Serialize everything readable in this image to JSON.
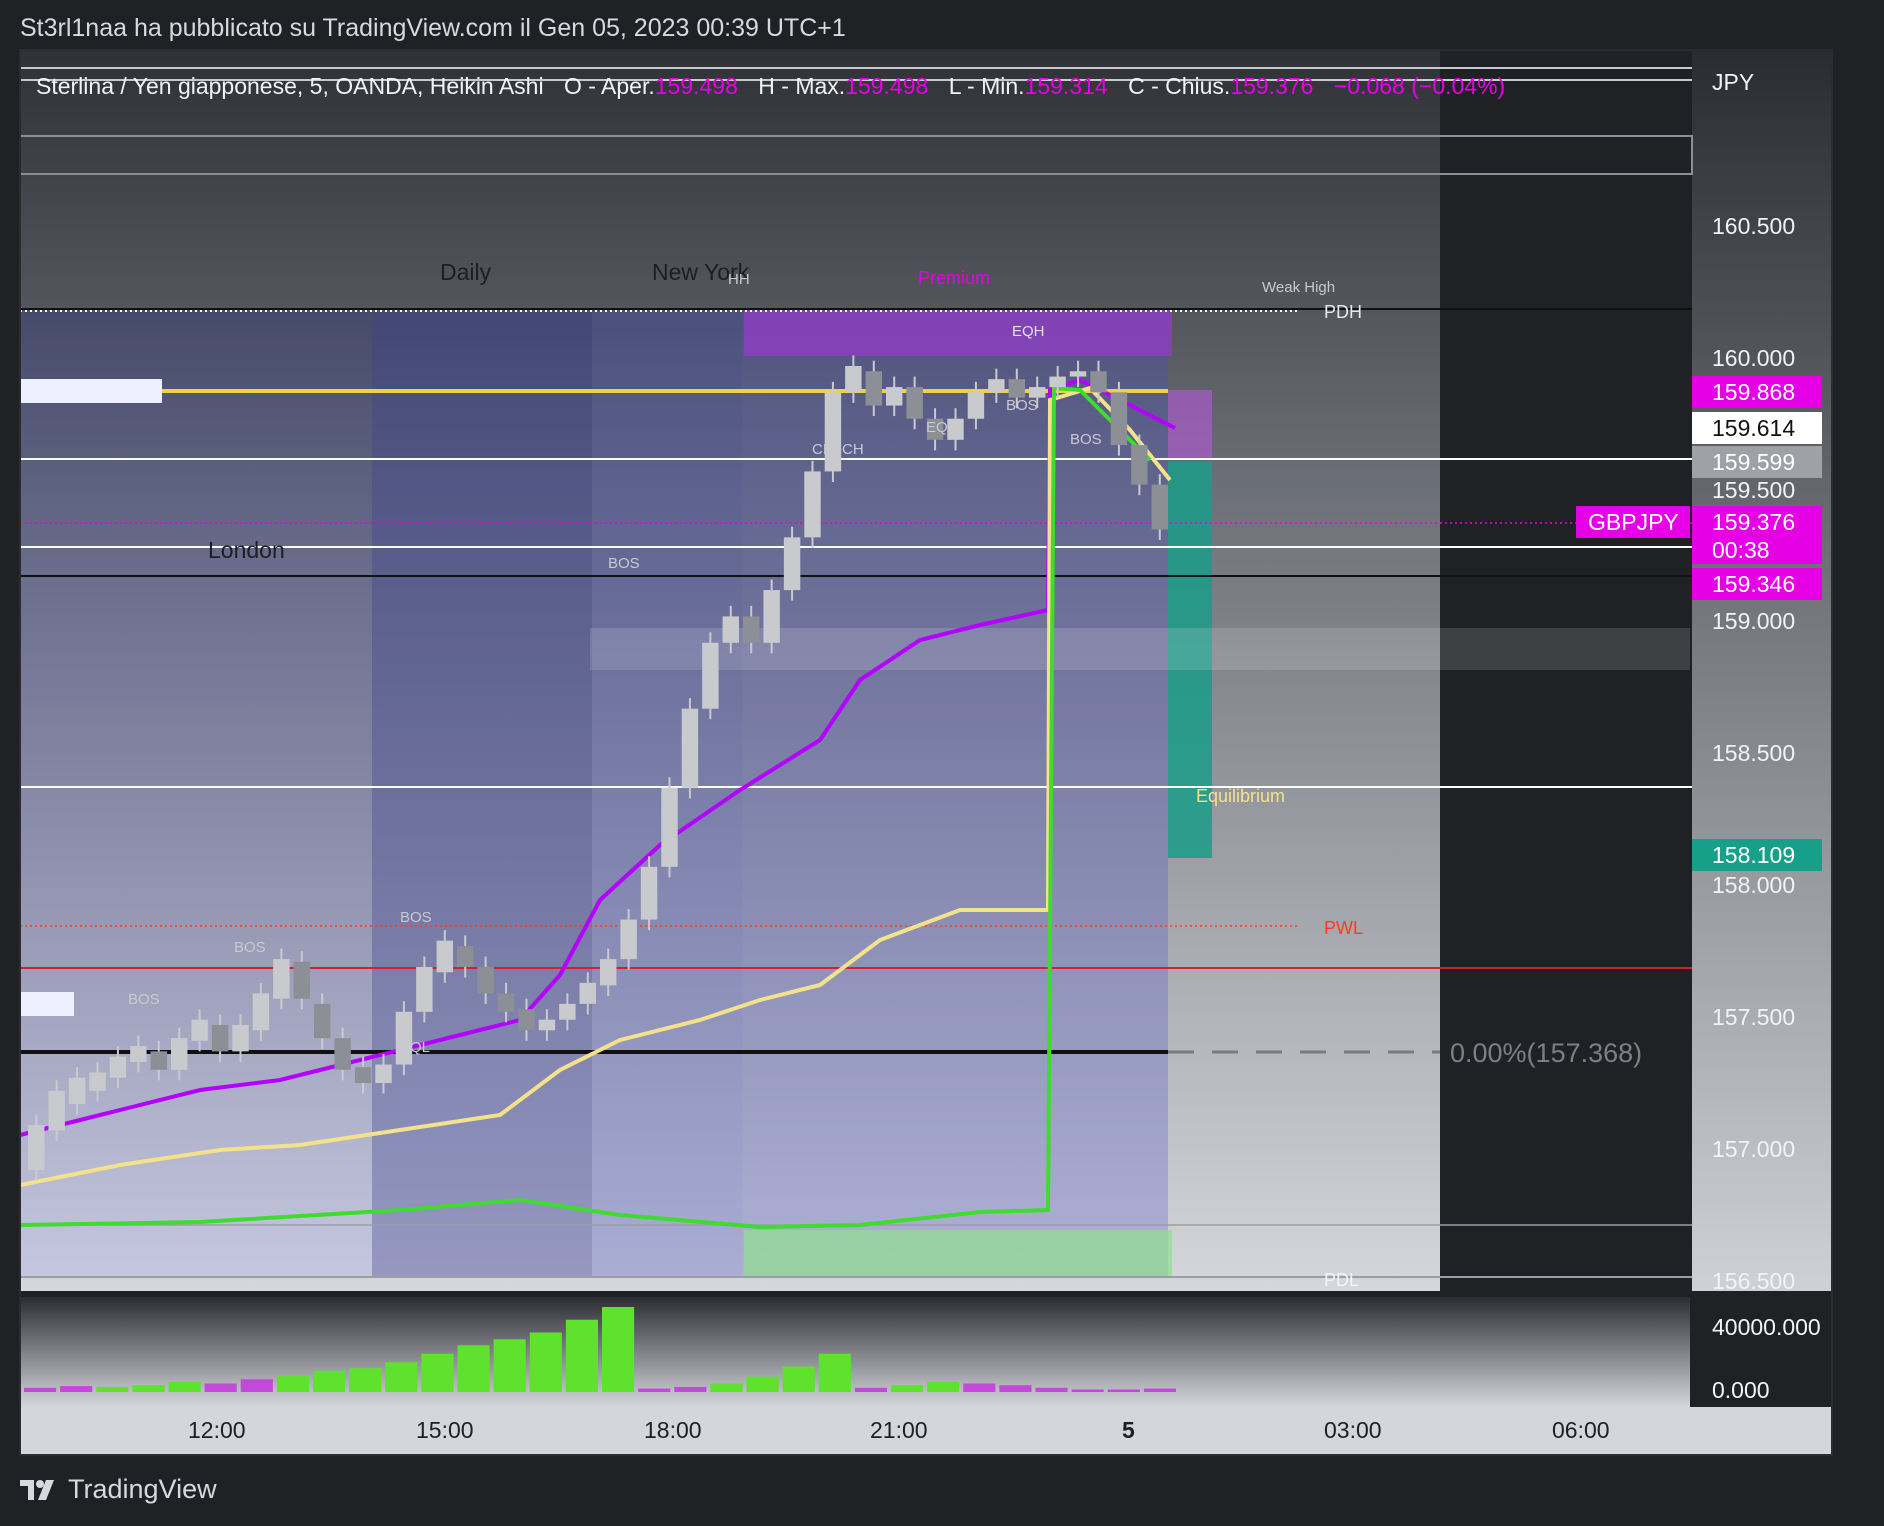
{
  "header": {
    "publish_line": "St3rl1naa ha pubblicato su TradingView.com il Gen 05, 2023 00:39 UTC+1"
  },
  "footer": {
    "brand": "TradingView"
  },
  "colors": {
    "magenta": "#e600e6",
    "price_yellow": "#f0d23c",
    "ema_purple": "#b400ff",
    "ema_yellow": "#f3e28a",
    "ema_green": "#4cd137",
    "teal": "#16a08a",
    "pwl_red": "#ff3b1e",
    "up_volume": "#5ee22e",
    "down_volume": "#c34ad8"
  },
  "chart_data": {
    "type": "candlestick",
    "symbol_line": {
      "name": "Sterlina / Yen giapponese, 5, OANDA, Heikin Ashi",
      "open_label": "O - Aper.",
      "open": "159.498",
      "high_label": "H - Max.",
      "high": "159.498",
      "low_label": "L - Min.",
      "low": "159.314",
      "close_label": "C - Chius.",
      "close": "159.376",
      "change": "−0.068 (−0.04%)"
    },
    "currency": "JPY",
    "y_ticks": [
      "160.500",
      "160.000",
      "159.500",
      "159.000",
      "158.500",
      "158.000",
      "157.500",
      "157.000",
      "156.500"
    ],
    "x_ticks": [
      "12:00",
      "15:00",
      "18:00",
      "21:00",
      "5",
      "03:00",
      "06:00"
    ],
    "volume_ticks": [
      "40000.000",
      "0.000"
    ],
    "price_tags": [
      {
        "value": "159.868",
        "style": "magenta"
      },
      {
        "value": "159.614",
        "style": "white"
      },
      {
        "value": "159.599",
        "style": "grey"
      },
      {
        "value": "159.376",
        "style": "magenta",
        "symbol": "GBPJPY",
        "countdown": "00:38"
      },
      {
        "value": "159.346",
        "style": "magenta"
      },
      {
        "value": "158.109",
        "style": "teal"
      }
    ],
    "sessions": [
      "Daily",
      "London",
      "New York"
    ],
    "structure_labels": [
      "BOS",
      "BOS",
      "BOS",
      "EQL",
      "BOS",
      "HH",
      "CHoCH",
      "EQL",
      "EQH",
      "BOS",
      "BOS"
    ],
    "zone_labels": {
      "premium": "Premium",
      "equilibrium": "Equilibrium",
      "weak_high": "Weak High",
      "pdh": "PDH",
      "pdl": "PDL",
      "pwl": "PWL"
    },
    "fib_label": "0.00%(157.368)",
    "candles": [
      [
        156.95,
        157.12
      ],
      [
        157.1,
        157.25
      ],
      [
        157.2,
        157.3
      ],
      [
        157.25,
        157.32
      ],
      [
        157.3,
        157.38
      ],
      [
        157.36,
        157.42
      ],
      [
        157.4,
        157.33
      ],
      [
        157.33,
        157.45
      ],
      [
        157.44,
        157.52
      ],
      [
        157.5,
        157.4
      ],
      [
        157.4,
        157.5
      ],
      [
        157.48,
        157.62
      ],
      [
        157.6,
        157.75
      ],
      [
        157.74,
        157.6
      ],
      [
        157.58,
        157.45
      ],
      [
        157.45,
        157.33
      ],
      [
        157.34,
        157.28
      ],
      [
        157.28,
        157.35
      ],
      [
        157.35,
        157.55
      ],
      [
        157.55,
        157.72
      ],
      [
        157.7,
        157.82
      ],
      [
        157.8,
        157.72
      ],
      [
        157.72,
        157.62
      ],
      [
        157.62,
        157.55
      ],
      [
        157.56,
        157.48
      ],
      [
        157.48,
        157.52
      ],
      [
        157.52,
        157.58
      ],
      [
        157.58,
        157.66
      ],
      [
        157.65,
        157.75
      ],
      [
        157.75,
        157.9
      ],
      [
        157.9,
        158.1
      ],
      [
        158.1,
        158.4
      ],
      [
        158.4,
        158.7
      ],
      [
        158.7,
        158.95
      ],
      [
        158.95,
        159.05
      ],
      [
        159.05,
        158.95
      ],
      [
        158.95,
        159.15
      ],
      [
        159.15,
        159.35
      ],
      [
        159.35,
        159.6
      ],
      [
        159.6,
        159.9
      ],
      [
        159.9,
        160.0
      ],
      [
        159.98,
        159.85
      ],
      [
        159.85,
        159.92
      ],
      [
        159.92,
        159.8
      ],
      [
        159.8,
        159.72
      ],
      [
        159.72,
        159.8
      ],
      [
        159.8,
        159.9
      ],
      [
        159.9,
        159.95
      ],
      [
        159.95,
        159.88
      ],
      [
        159.88,
        159.92
      ],
      [
        159.92,
        159.96
      ],
      [
        159.96,
        159.98
      ],
      [
        159.98,
        159.9
      ],
      [
        159.9,
        159.7
      ],
      [
        159.7,
        159.55
      ],
      [
        159.55,
        159.38
      ]
    ],
    "volume": [
      [
        5,
        1
      ],
      [
        7,
        1
      ],
      [
        6,
        0
      ],
      [
        8,
        0
      ],
      [
        12,
        0
      ],
      [
        10,
        1
      ],
      [
        15,
        1
      ],
      [
        20,
        0
      ],
      [
        25,
        0
      ],
      [
        28,
        0
      ],
      [
        35,
        0
      ],
      [
        45,
        0
      ],
      [
        55,
        0
      ],
      [
        62,
        0
      ],
      [
        70,
        0
      ],
      [
        85,
        0
      ],
      [
        100,
        0
      ],
      [
        4,
        1
      ],
      [
        6,
        1
      ],
      [
        10,
        0
      ],
      [
        18,
        0
      ],
      [
        30,
        0
      ],
      [
        45,
        0
      ],
      [
        5,
        1
      ],
      [
        8,
        0
      ],
      [
        12,
        0
      ],
      [
        10,
        1
      ],
      [
        8,
        1
      ],
      [
        5,
        1
      ],
      [
        3,
        1
      ],
      [
        3,
        1
      ],
      [
        4,
        1
      ]
    ]
  }
}
